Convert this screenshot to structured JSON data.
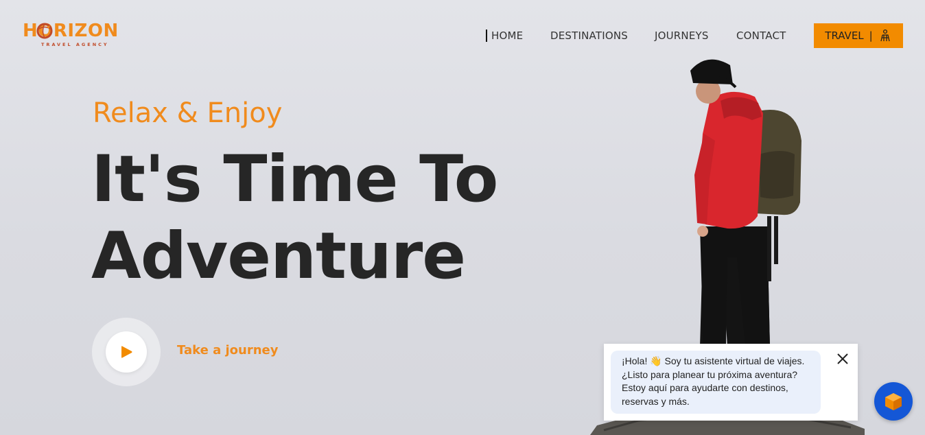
{
  "brand": {
    "name": "HORIZON",
    "tagline": "TRAVEL AGENCY",
    "accent": "#f08b1d"
  },
  "nav": {
    "items": [
      {
        "label": "HOME"
      },
      {
        "label": "DESTINATIONS"
      },
      {
        "label": "JOURNEYS"
      },
      {
        "label": "CONTACT"
      }
    ],
    "cta": {
      "label": "TRAVEL",
      "separator": "|",
      "icon": "hiker-icon",
      "color": "#f28b00"
    }
  },
  "hero": {
    "eyebrow": "Relax & Enjoy",
    "headline_line1": "It's Time To",
    "headline_line2": "Adventure",
    "play_icon": "play-icon",
    "cta_label": "Take a journey"
  },
  "chat": {
    "message_line1": "¡Hola! 👋 Soy tu asistente virtual de viajes.",
    "message_line2": "¿Listo para planear tu próxima aventura?",
    "message_line3": "Estoy aquí para ayudarte con destinos,",
    "message_line4": "reservas y más.",
    "close_icon": "close-icon",
    "launcher_icon": "cube-icon",
    "launcher_color": "#1457d6"
  }
}
